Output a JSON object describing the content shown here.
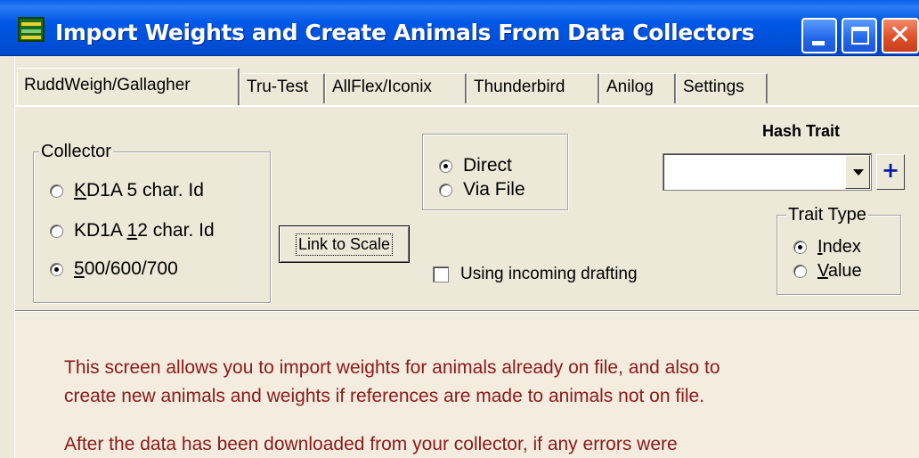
{
  "window": {
    "title": "Import Weights and Create Animals From Data Collectors",
    "icon": "app-farm-icon",
    "controls": {
      "minimize": "minimize-icon",
      "maximize": "maximize-icon",
      "close": "✕"
    }
  },
  "tabs": [
    {
      "label": "RuddWeigh/Gallagher",
      "active": true
    },
    {
      "label": "Tru-Test"
    },
    {
      "label": "AllFlex/Iconix"
    },
    {
      "label": "Thunderbird"
    },
    {
      "label": "Anilog"
    },
    {
      "label": "Settings"
    }
  ],
  "collector": {
    "legend": "Collector",
    "options": [
      {
        "prefix": "",
        "mnemonic": "K",
        "rest": "D1A 5 char. Id",
        "checked": false
      },
      {
        "prefix": "KD1A ",
        "mnemonic": "1",
        "rest": "2 char. Id",
        "checked": false
      },
      {
        "prefix": "",
        "mnemonic": "5",
        "rest": "00/600/700",
        "checked": true
      }
    ]
  },
  "link_button": {
    "label": "Link to Scale"
  },
  "connection": {
    "options": [
      {
        "label": "Direct",
        "checked": true
      },
      {
        "label": "Via File",
        "checked": false
      }
    ]
  },
  "drafting": {
    "label": "Using incoming drafting",
    "checked": false
  },
  "hash_trait": {
    "label": "Hash Trait",
    "value": "",
    "add_label": "+"
  },
  "trait_type": {
    "legend": "Trait Type",
    "options": [
      {
        "mnemonic": "I",
        "rest": "ndex",
        "checked": true
      },
      {
        "mnemonic": "V",
        "rest": "alue",
        "checked": false
      }
    ]
  },
  "info": {
    "lines": [
      "This screen allows you to import weights for animals already on file, and also to",
      "create new animals and weights if references are made to animals not on file.",
      "After the data has been downloaded from your collector, if any errors were"
    ]
  },
  "colors": {
    "title_bar": "#0054e3",
    "info_text": "#8a1a1a",
    "plus": "#0a1aa0"
  }
}
